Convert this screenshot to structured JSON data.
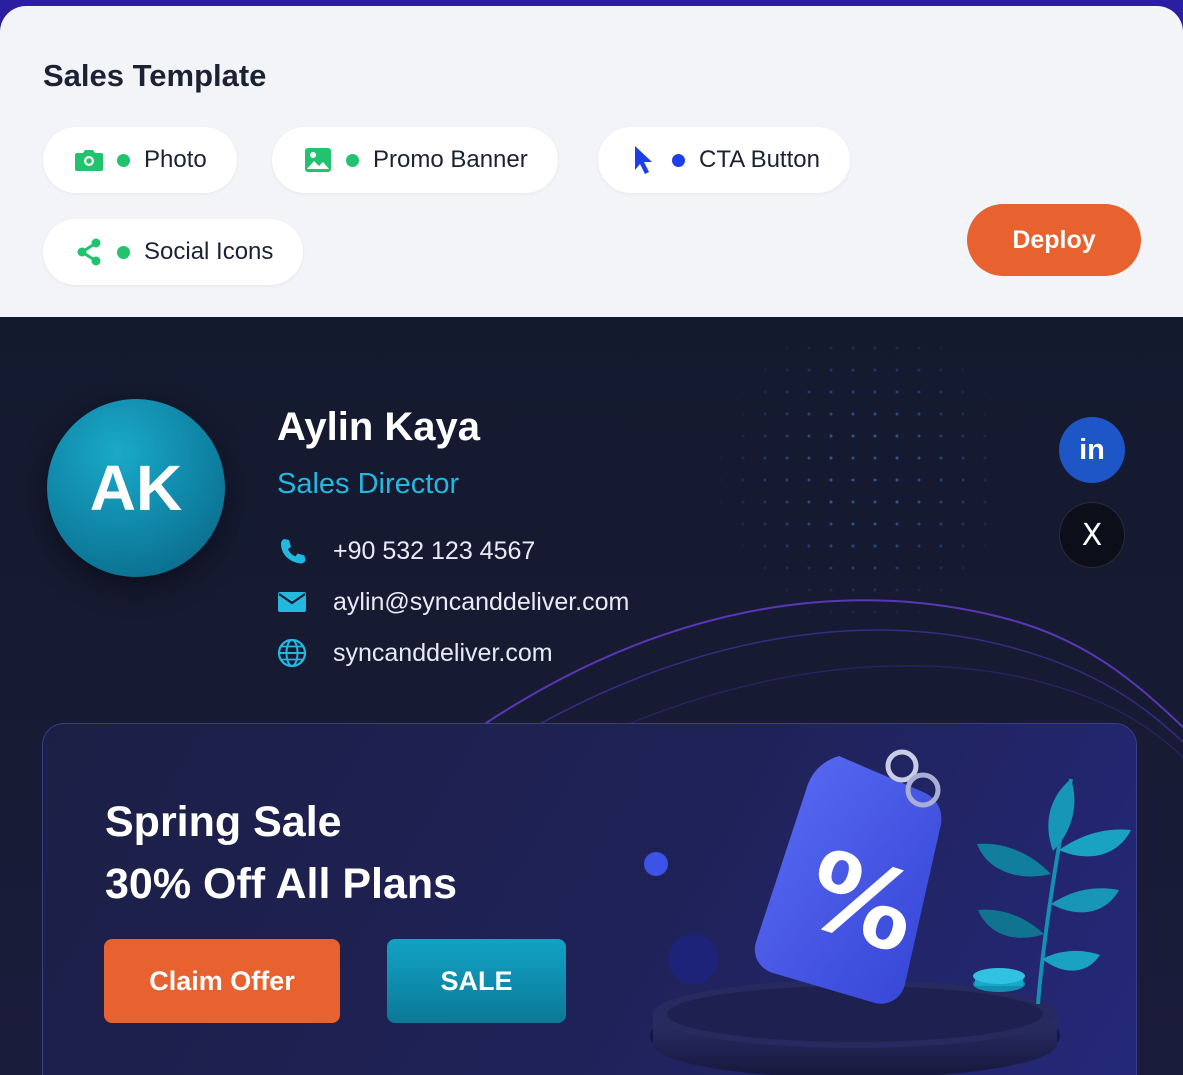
{
  "header": {
    "title": "Sales Template",
    "deploy_label": "Deploy"
  },
  "chips": [
    {
      "label": "Photo",
      "icon": "camera-icon",
      "color": "#22c36e"
    },
    {
      "label": "Promo Banner",
      "icon": "image-icon",
      "color": "#22c36e"
    },
    {
      "label": "CTA Button",
      "icon": "cursor-icon",
      "color": "#1d3ee8"
    },
    {
      "label": "Social Icons",
      "icon": "share-icon",
      "color": "#22c36e"
    }
  ],
  "signature": {
    "initials": "AK",
    "name": "Aylin Kaya",
    "role": "Sales Director",
    "phone": "+90 532 123 4567",
    "email": "aylin@syncanddeliver.com",
    "website": "syncanddeliver.com",
    "social": [
      {
        "label": "in",
        "icon": "linkedin-icon",
        "color": "#1e56c8"
      },
      {
        "label": "X",
        "icon": "x-icon",
        "color": "#0c0f1a"
      }
    ]
  },
  "promo": {
    "line1": "Spring Sale",
    "line2": "30% Off All Plans",
    "claim_label": "Claim Offer",
    "sale_label": "SALE",
    "tag_symbol": "%"
  },
  "colors": {
    "accent_orange": "#e8622f",
    "accent_cyan": "#22b8e0",
    "green_dot": "#22c36e",
    "blue_dot": "#1d3ee8"
  }
}
